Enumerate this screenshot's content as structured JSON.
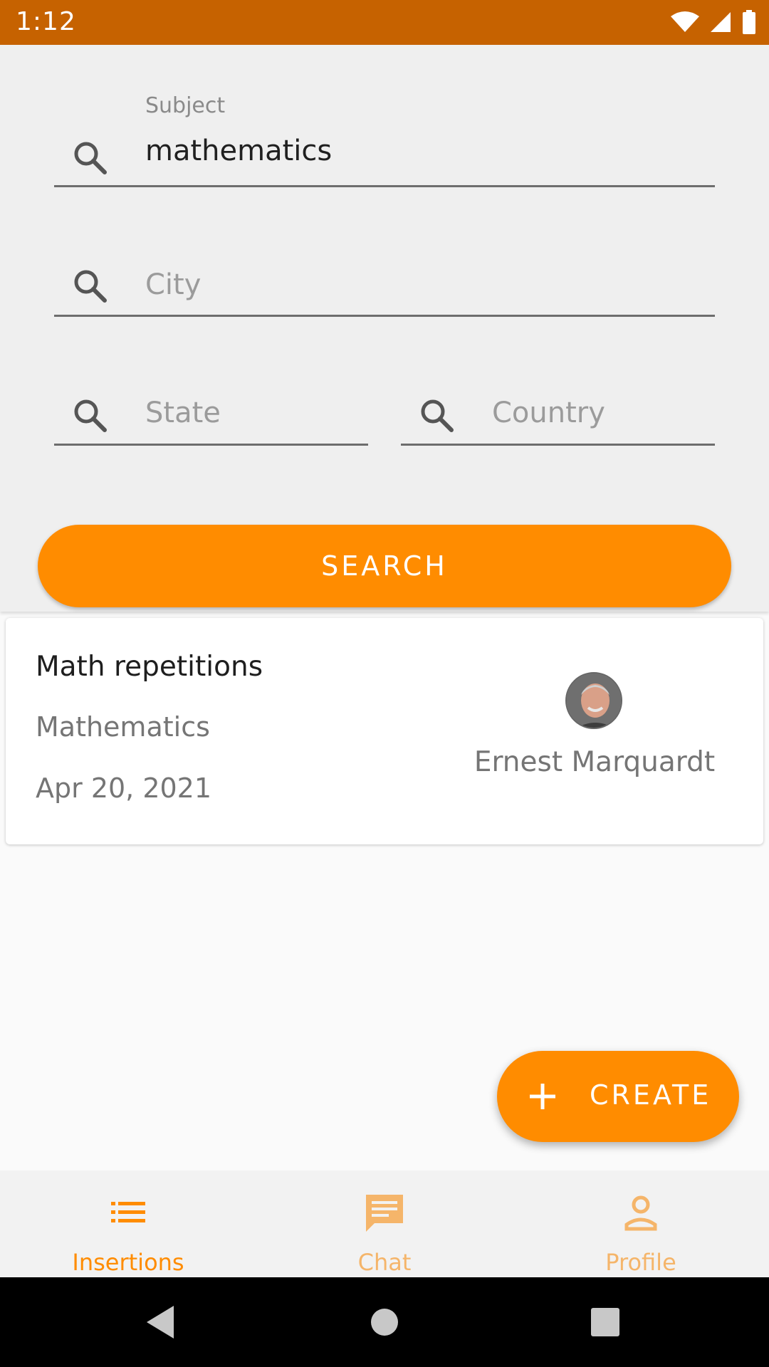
{
  "status_bar": {
    "time": "1:12"
  },
  "search_form": {
    "subject_label": "Subject",
    "subject_value": "mathematics",
    "city_placeholder": "City",
    "state_placeholder": "State",
    "country_placeholder": "Country",
    "search_button": "SEARCH"
  },
  "results": [
    {
      "title": "Math repetitions",
      "subject": "Mathematics",
      "date": "Apr 20, 2021",
      "author": "Ernest Marquardt"
    }
  ],
  "fab": {
    "label": "CREATE"
  },
  "bottom_nav": [
    {
      "label": "Insertions",
      "icon": "list-icon",
      "active": true
    },
    {
      "label": "Chat",
      "icon": "chat-icon",
      "active": false
    },
    {
      "label": "Profile",
      "icon": "person-icon",
      "active": false
    }
  ],
  "colors": {
    "accent": "#ff8c00",
    "status_bar": "#c66200",
    "inactive_nav": "#f5b56a"
  }
}
